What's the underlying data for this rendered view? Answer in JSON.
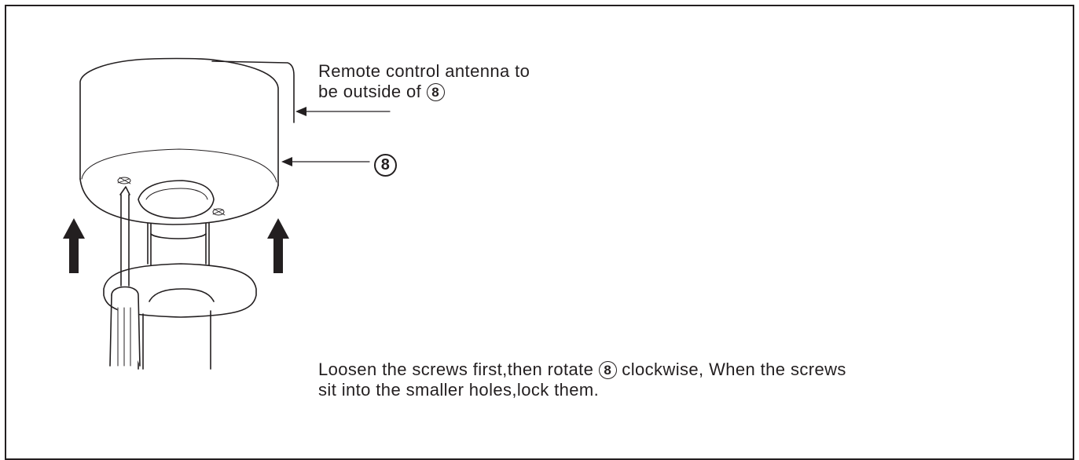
{
  "callouts": {
    "antenna_line1": "Remote control antenna to",
    "antenna_line2_prefix": "be outside of ",
    "part_number": "8",
    "part_label": "8"
  },
  "instruction": {
    "line1_prefix": "Loosen the screws first,then rotate ",
    "part_number": "8",
    "line1_suffix": " clockwise, When the screws",
    "line2": "sit into the smaller holes,lock them."
  }
}
